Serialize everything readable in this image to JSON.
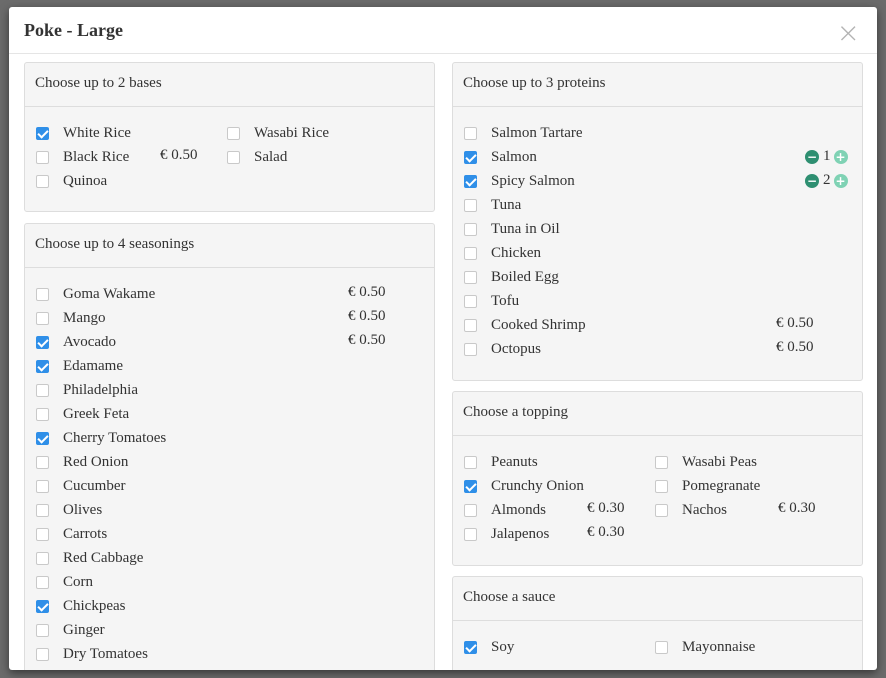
{
  "modal": {
    "title": "Poke - Large",
    "close_label": "×"
  },
  "bases": {
    "heading": "Choose up to 2 bases",
    "options": [
      {
        "label": "White Rice",
        "checked": true,
        "price": ""
      },
      {
        "label": "Wasabi Rice",
        "checked": false,
        "price": ""
      },
      {
        "label": "Black Rice",
        "checked": false,
        "price": "€ 0.50"
      },
      {
        "label": "Salad",
        "checked": false,
        "price": ""
      },
      {
        "label": "Quinoa",
        "checked": false,
        "price": ""
      }
    ]
  },
  "seasonings": {
    "heading": "Choose up to 4 seasonings",
    "options": [
      {
        "label": "Goma Wakame",
        "checked": false,
        "price": "€ 0.50"
      },
      {
        "label": "Mango",
        "checked": false,
        "price": "€ 0.50"
      },
      {
        "label": "Avocado",
        "checked": true,
        "price": "€ 0.50"
      },
      {
        "label": "Edamame",
        "checked": true,
        "price": ""
      },
      {
        "label": "Philadelphia",
        "checked": false,
        "price": ""
      },
      {
        "label": "Greek Feta",
        "checked": false,
        "price": ""
      },
      {
        "label": "Cherry Tomatoes",
        "checked": true,
        "price": ""
      },
      {
        "label": "Red Onion",
        "checked": false,
        "price": ""
      },
      {
        "label": "Cucumber",
        "checked": false,
        "price": ""
      },
      {
        "label": "Olives",
        "checked": false,
        "price": ""
      },
      {
        "label": "Carrots",
        "checked": false,
        "price": ""
      },
      {
        "label": "Red Cabbage",
        "checked": false,
        "price": ""
      },
      {
        "label": "Corn",
        "checked": false,
        "price": ""
      },
      {
        "label": "Chickpeas",
        "checked": true,
        "price": ""
      },
      {
        "label": "Ginger",
        "checked": false,
        "price": ""
      },
      {
        "label": "Dry Tomatoes",
        "checked": false,
        "price": ""
      }
    ]
  },
  "proteins": {
    "heading": "Choose up to 3 proteins",
    "options": [
      {
        "label": "Salmon Tartare",
        "checked": false,
        "price": "",
        "qty": ""
      },
      {
        "label": "Salmon",
        "checked": true,
        "price": "",
        "qty": "1"
      },
      {
        "label": "Spicy Salmon",
        "checked": true,
        "price": "",
        "qty": "2"
      },
      {
        "label": "Tuna",
        "checked": false,
        "price": "",
        "qty": ""
      },
      {
        "label": "Tuna in Oil",
        "checked": false,
        "price": "",
        "qty": ""
      },
      {
        "label": "Chicken",
        "checked": false,
        "price": "",
        "qty": ""
      },
      {
        "label": "Boiled Egg",
        "checked": false,
        "price": "",
        "qty": ""
      },
      {
        "label": "Tofu",
        "checked": false,
        "price": "",
        "qty": ""
      },
      {
        "label": "Cooked Shrimp",
        "checked": false,
        "price": "€ 0.50",
        "qty": ""
      },
      {
        "label": "Octopus",
        "checked": false,
        "price": "€ 0.50",
        "qty": ""
      }
    ],
    "minus_symbol": "−",
    "plus_symbol": "+"
  },
  "topping": {
    "heading": "Choose a topping",
    "options": [
      {
        "label": "Peanuts",
        "checked": false,
        "price": ""
      },
      {
        "label": "Wasabi Peas",
        "checked": false,
        "price": ""
      },
      {
        "label": "Crunchy Onion",
        "checked": true,
        "price": ""
      },
      {
        "label": "Pomegranate",
        "checked": false,
        "price": ""
      },
      {
        "label": "Almonds",
        "checked": false,
        "price": "€ 0.30"
      },
      {
        "label": "Nachos",
        "checked": false,
        "price": "€ 0.30"
      },
      {
        "label": "Jalapenos",
        "checked": false,
        "price": "€ 0.30"
      }
    ]
  },
  "sauce": {
    "heading": "Choose a sauce",
    "options": [
      {
        "label": "Soy",
        "checked": true,
        "price": ""
      },
      {
        "label": "Mayonnaise",
        "checked": false,
        "price": ""
      }
    ]
  },
  "colors": {
    "checked": "#2f8fe8",
    "stepper_minus": "#2e8f71",
    "stepper_plus": "#7fd2b4"
  },
  "icons": {
    "close": "close-icon",
    "minus": "minus-circle-icon",
    "plus": "plus-circle-icon",
    "check": "checkbox-icon"
  }
}
